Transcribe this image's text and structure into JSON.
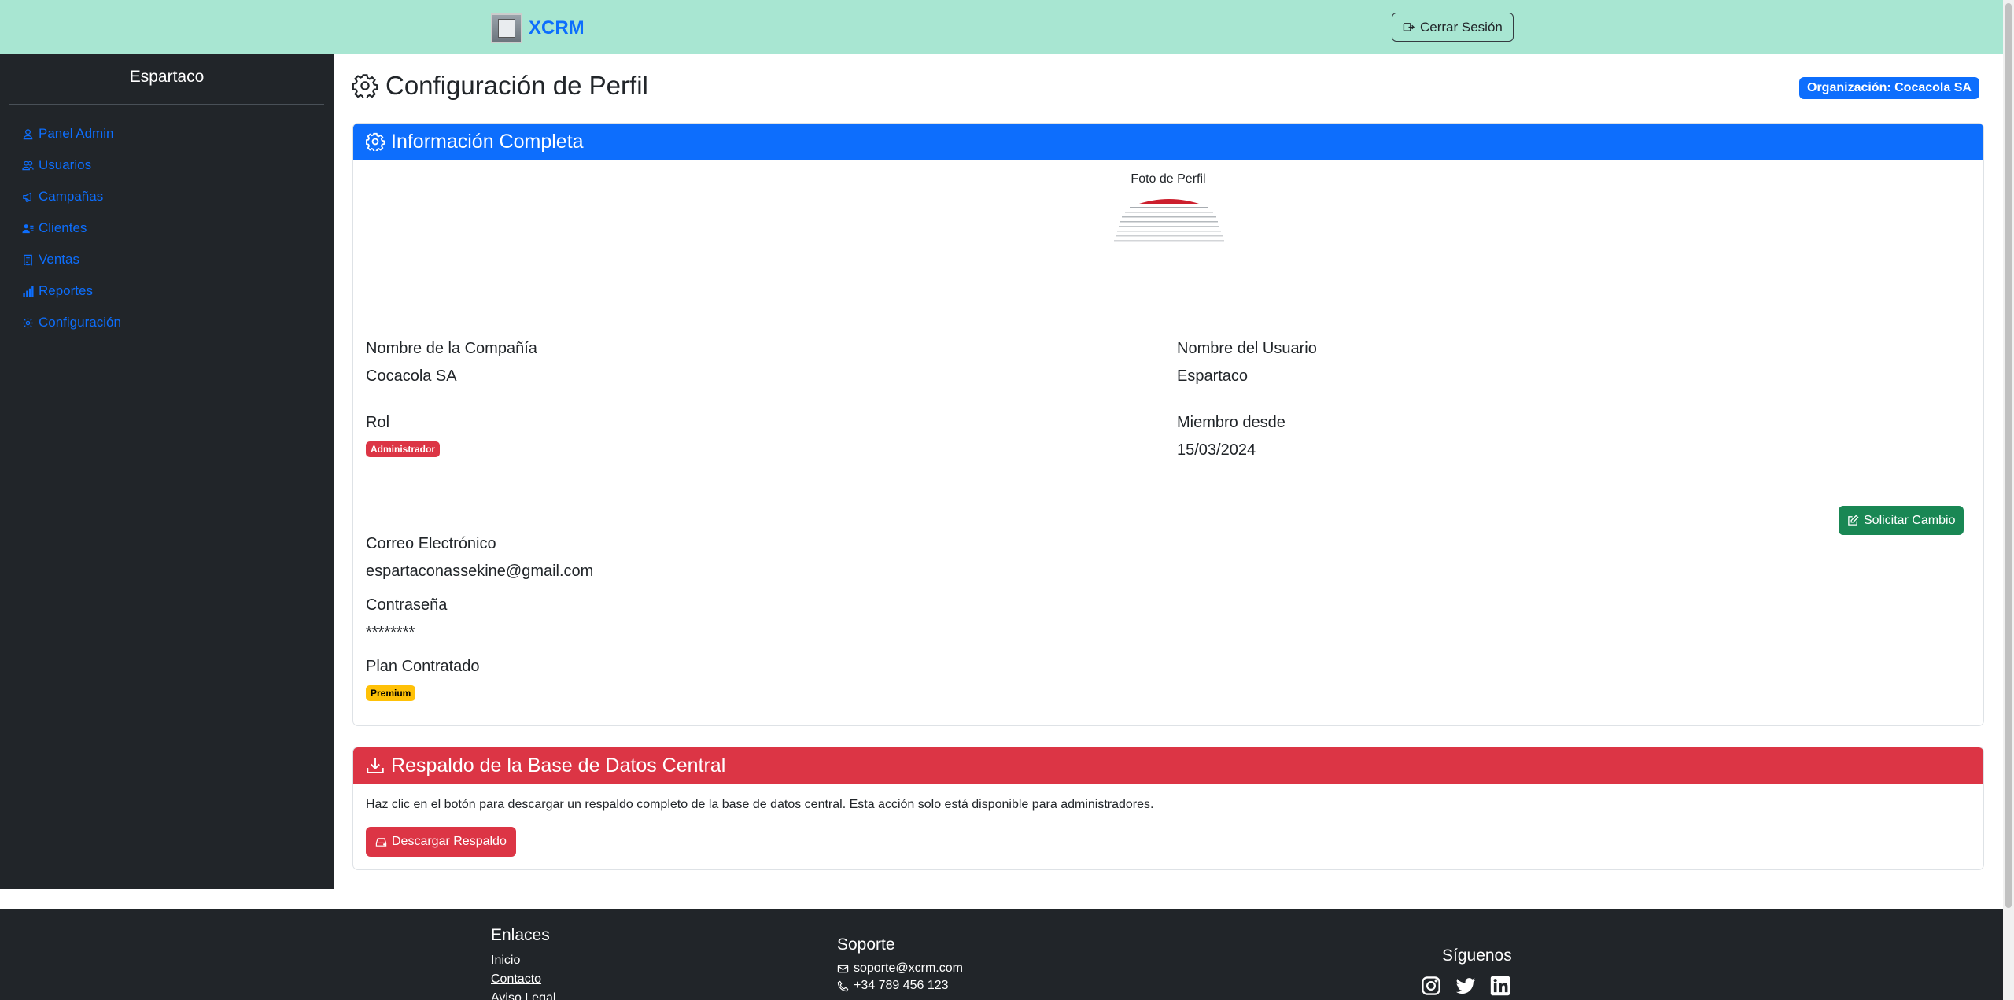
{
  "app": {
    "brand": "XCRM",
    "logout_label": "Cerrar Sesión"
  },
  "sidebar": {
    "user_name": "Espartaco",
    "items": [
      {
        "label": "Panel Admin",
        "icon": "person-icon"
      },
      {
        "label": "Usuarios",
        "icon": "people-icon"
      },
      {
        "label": "Campañas",
        "icon": "megaphone-icon"
      },
      {
        "label": "Clientes",
        "icon": "person-lines-icon"
      },
      {
        "label": "Ventas",
        "icon": "receipt-icon"
      },
      {
        "label": "Reportes",
        "icon": "bar-chart-icon"
      },
      {
        "label": "Configuración",
        "icon": "gear-icon"
      }
    ]
  },
  "page": {
    "title": "Configuración de Perfil",
    "org_badge": "Organización: Cocacola SA"
  },
  "info_card": {
    "title": "Información Completa",
    "photo_label": "Foto de Perfil",
    "company_label": "Nombre de la Compañía",
    "company_value": "Cocacola SA",
    "user_label": "Nombre del Usuario",
    "user_value": "Espartaco",
    "role_label": "Rol",
    "role_value": "Administrador",
    "member_label": "Miembro desde",
    "member_value": "15/03/2024",
    "request_button": "Solicitar Cambio",
    "email_label": "Correo Electrónico",
    "email_value": "espartaconassekine@gmail.com",
    "password_label": "Contraseña",
    "password_value": "********",
    "plan_label": "Plan Contratado",
    "plan_value": "Premium"
  },
  "backup_card": {
    "title": "Respaldo de la Base de Datos Central",
    "description": "Haz clic en el botón para descargar un respaldo completo de la base de datos central. Esta acción solo está disponible para administradores.",
    "button": "Descargar Respaldo"
  },
  "footer": {
    "links_title": "Enlaces",
    "links": [
      "Inicio",
      "Contacto",
      "Aviso Legal"
    ],
    "support_title": "Soporte",
    "support_email": "soporte@xcrm.com",
    "support_phone": "+34 789 456 123",
    "social_title": "Síguenos",
    "social": [
      "instagram-icon",
      "twitter-icon",
      "linkedin-icon"
    ]
  },
  "colors": {
    "topbar": "#a8e6d2",
    "primary": "#0d6efd",
    "danger": "#dc3545",
    "success": "#198754",
    "warning": "#ffc107",
    "dark": "#212529"
  }
}
